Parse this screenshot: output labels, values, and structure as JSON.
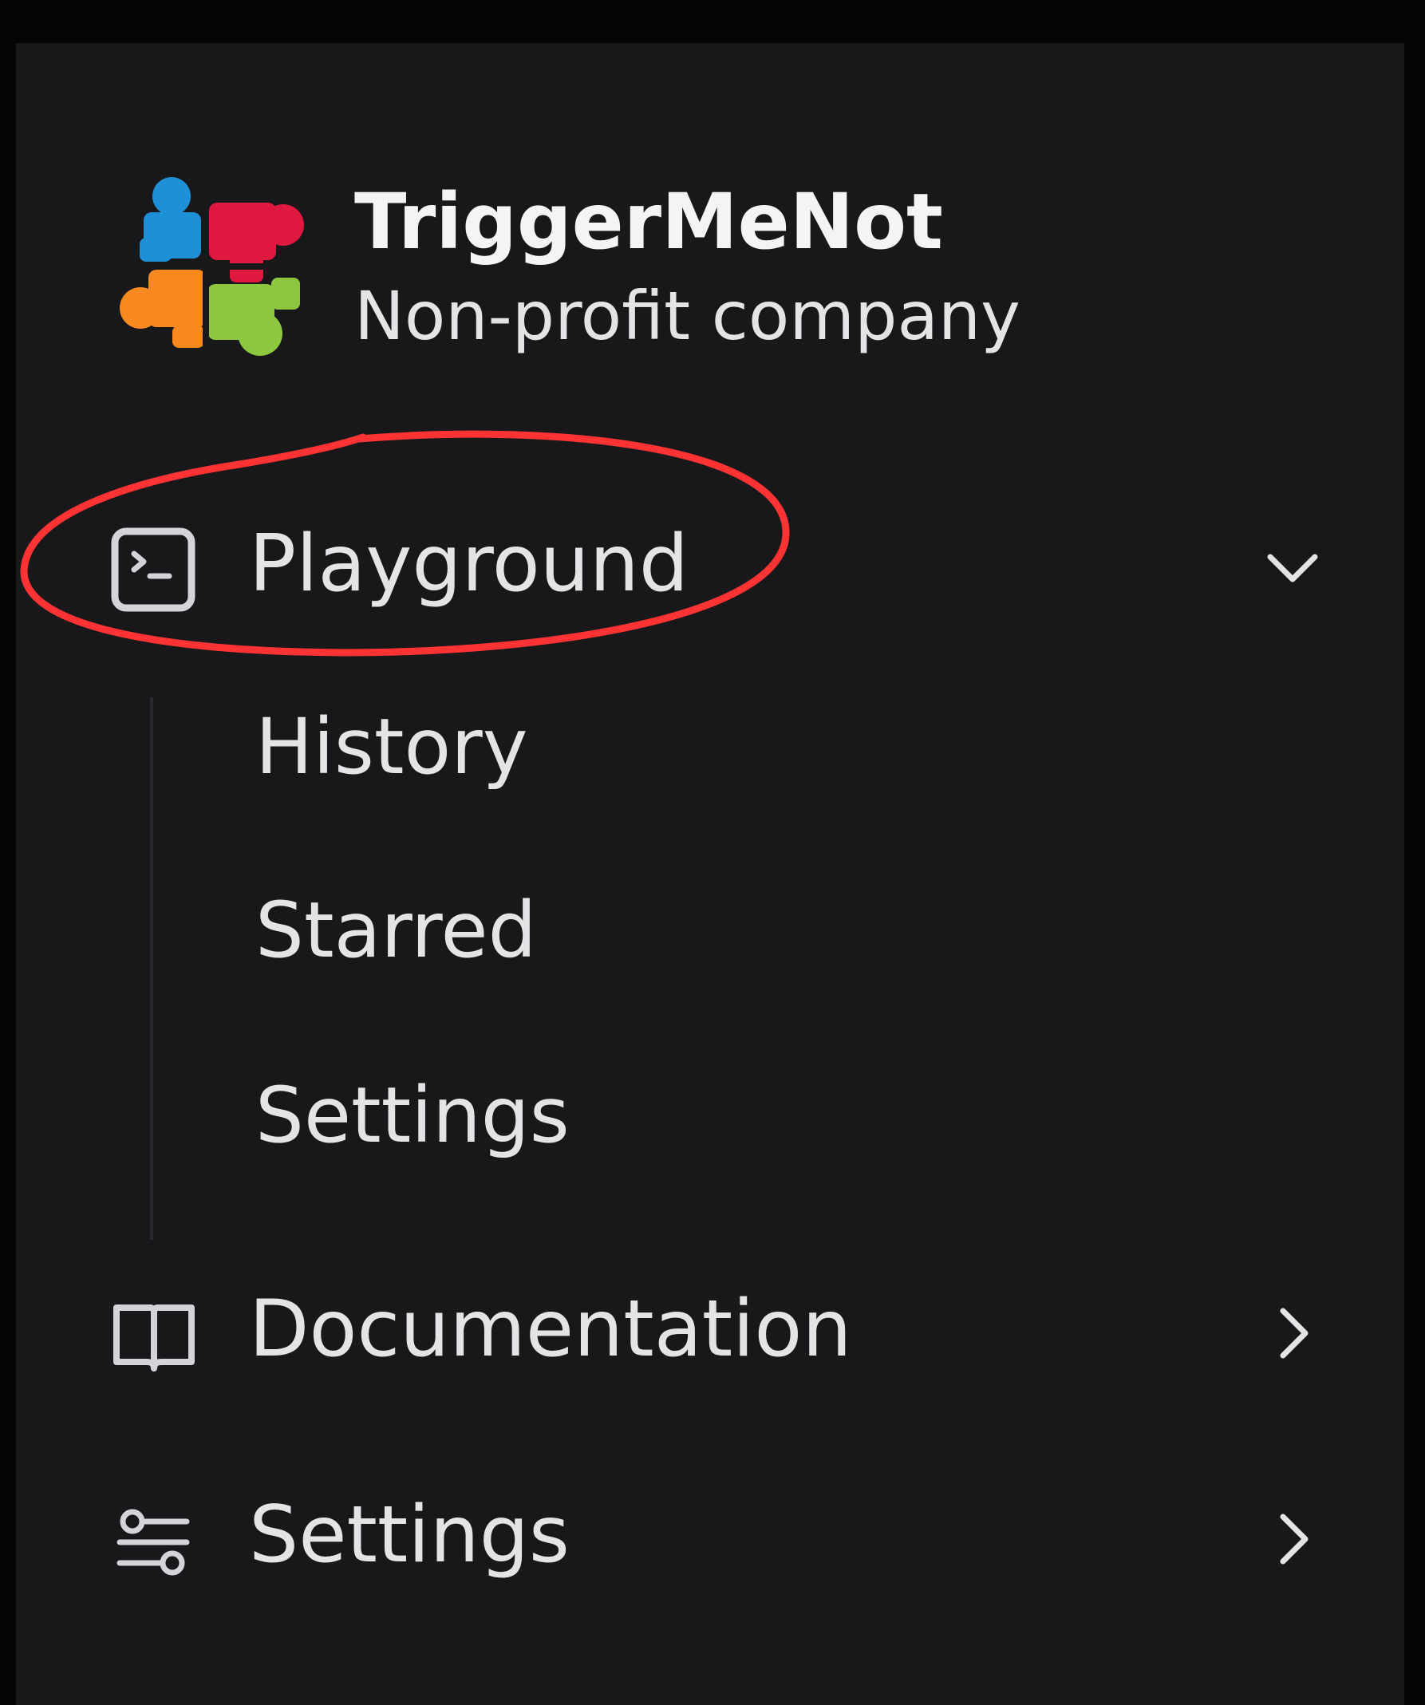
{
  "brand": {
    "name": "TriggerMeNot",
    "subtitle": "Non-profit company",
    "logo_icon": "puzzle-logo-icon"
  },
  "nav": {
    "items": [
      {
        "label": "Playground",
        "icon": "terminal-icon",
        "chevron": "chevron-down-icon",
        "expanded": true
      },
      {
        "label": "Documentation",
        "icon": "book-icon",
        "chevron": "chevron-right-icon",
        "expanded": false
      },
      {
        "label": "Settings",
        "icon": "sliders-icon",
        "chevron": "chevron-right-icon",
        "expanded": false
      }
    ],
    "playground_subitems": [
      {
        "label": "History"
      },
      {
        "label": "Starred"
      },
      {
        "label": "Settings"
      }
    ]
  },
  "colors": {
    "page_background": "#050505",
    "sidebar_background": "#18181b",
    "text": "#e4e4e7",
    "annotation": "#ff3333",
    "logo_blue": "#1e90d8",
    "logo_red": "#e0173f",
    "logo_orange": "#f7891f",
    "logo_green": "#8dc63f"
  }
}
